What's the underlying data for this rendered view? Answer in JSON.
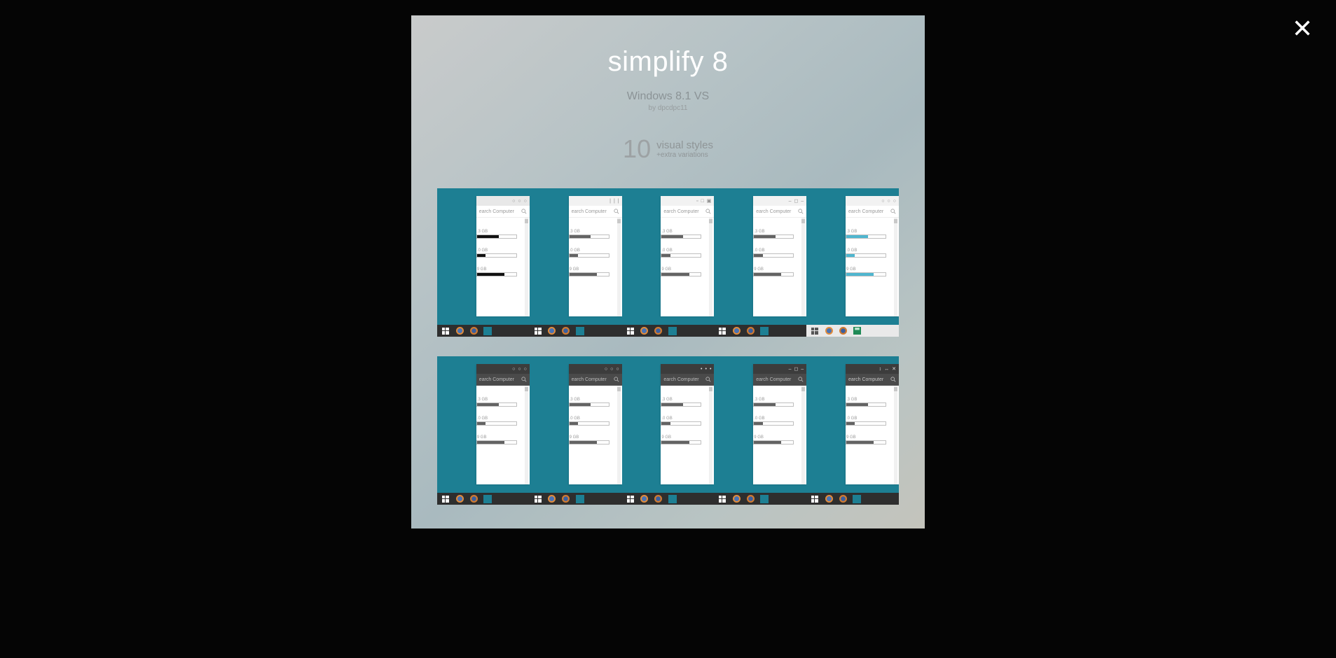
{
  "viewer": {
    "close_label": "Close"
  },
  "hero": {
    "title": "simplify 8",
    "subtitle": "Windows 8.1 VS",
    "byline": "by dpcdpc11",
    "count_num": "10",
    "count_line1": "visual styles",
    "count_line2": "+extra variations"
  },
  "tile_common": {
    "search_text": "arch Computer",
    "search_text_full": "earch Computer",
    "row1_label": ".3 GB",
    "row2_label": ".0 GB",
    "row3_label": "9 GB",
    "fill1_pct": 55,
    "fill2_pct": 22,
    "fill3_pct": 70
  },
  "tiles_top": [
    {
      "titlebar_variant": "circles",
      "theme": "lightcolor",
      "bar": "dark",
      "fill": "black"
    },
    {
      "titlebar_variant": "lines",
      "theme": "light",
      "bar": "dark",
      "fill": "gray"
    },
    {
      "titlebar_variant": "squares",
      "theme": "light",
      "bar": "dark",
      "fill": "gray"
    },
    {
      "titlebar_variant": "dashes",
      "theme": "light",
      "bar": "dark",
      "fill": "gray"
    },
    {
      "titlebar_variant": "circles",
      "theme": "light",
      "bar": "light",
      "fill": "accent"
    }
  ],
  "tiles_bottom": [
    {
      "titlebar_variant": "circles",
      "theme": "dark",
      "bar": "dark",
      "fill": "gray"
    },
    {
      "titlebar_variant": "circles",
      "theme": "dark",
      "bar": "dark",
      "fill": "gray"
    },
    {
      "titlebar_variant": "dots",
      "theme": "dark",
      "bar": "dark",
      "fill": "gray"
    },
    {
      "titlebar_variant": "dashes",
      "theme": "dark",
      "bar": "dark",
      "fill": "gray"
    },
    {
      "titlebar_variant": "arrows",
      "theme": "dark",
      "bar": "dark",
      "fill": "gray",
      "darksearch": true
    }
  ],
  "titlebar_symbols": {
    "circles": [
      "○",
      "○",
      "○"
    ],
    "lines": [
      "|",
      "|",
      "|"
    ],
    "squares": [
      "▫",
      "□",
      "▣"
    ],
    "dashes": [
      "–",
      "◻",
      "–"
    ],
    "dots": [
      "•",
      "•",
      "•"
    ],
    "arrows": [
      "↕",
      "↔",
      "✕"
    ]
  }
}
